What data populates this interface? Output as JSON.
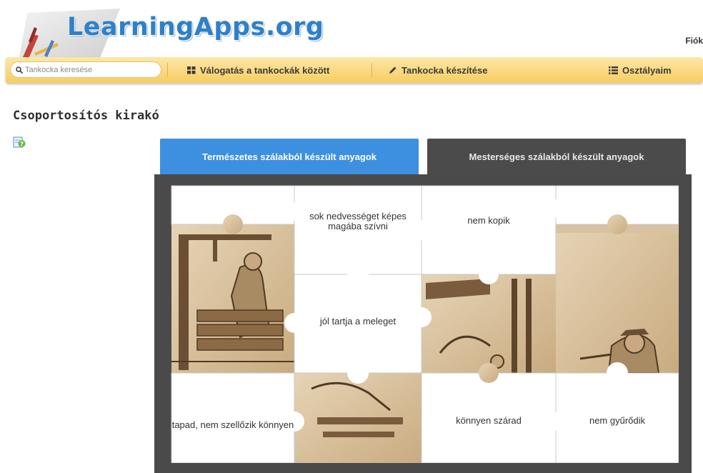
{
  "header": {
    "logo_text": "LearningApps.org",
    "account_label": "Fiók"
  },
  "navbar": {
    "search_placeholder": "Tankocka keresése",
    "browse_label": "Válogatás a tankockák között",
    "create_label": "Tankocka készítése",
    "classes_label": "Osztályaim"
  },
  "page": {
    "title": "Csoportosítós kirakó"
  },
  "tabs": {
    "natural": "Természetes szálakból készült anyagok",
    "artificial": "Mesterséges szálakból készült anyagok"
  },
  "pieces": {
    "absorbs_moisture": "sok nedvességet képes magába szívni",
    "does_not_pill": "nem kopik",
    "keeps_warm": "jól tartja a meleget",
    "sticks_not_breathable": "tapad, nem szellőzik könnyen",
    "dries_easily": "könnyen szárad",
    "does_not_wrinkle": "nem gyűrődik"
  },
  "colors": {
    "accent_blue": "#3d8fe0",
    "navbar_yellow": "#f8cd60",
    "board_dark": "#4a4a4a",
    "image_sepia": "#d9c2a0"
  },
  "icons": {
    "search": "search-icon",
    "browse": "grid-icon",
    "create": "pencil-icon",
    "classes": "list-icon",
    "help": "help-icon"
  }
}
